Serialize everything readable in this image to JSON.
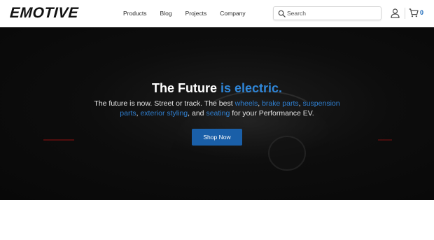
{
  "brand": {
    "logo_text": "EMOTIVE"
  },
  "nav": {
    "items": [
      {
        "label": "Products"
      },
      {
        "label": "Blog"
      },
      {
        "label": "Projects"
      },
      {
        "label": "Company"
      }
    ]
  },
  "search": {
    "placeholder": "Search",
    "value": ""
  },
  "cart": {
    "count": "0"
  },
  "hero": {
    "title_prefix": "The Future ",
    "title_accent": "is electric.",
    "body": {
      "part1": "The future is now. Street or track. The best ",
      "link_wheels": "wheels",
      "sep1": ", ",
      "link_brake": "brake parts",
      "sep2": ", ",
      "link_suspension": "suspension parts",
      "sep3": ", ",
      "link_exterior": "exterior styling",
      "sep4": ", and ",
      "link_seating": "seating",
      "part2": " for your Performance EV."
    },
    "cta_label": "Shop Now"
  },
  "colors": {
    "accent": "#2f86d8",
    "button": "#1a5fa8",
    "hero_bg": "#0d0d0d",
    "cart_count": "#1666b8"
  },
  "icons": {
    "search": "search-icon",
    "account": "user-icon",
    "cart": "cart-icon"
  }
}
